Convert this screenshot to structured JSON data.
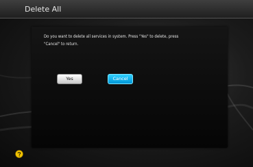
{
  "header": {
    "title": "Delete All"
  },
  "dialog": {
    "message": "Do you want to delete all services in system. Press \"Yes\" to delete, press \"Cancel\" to return.",
    "yes_label": "Yes",
    "cancel_label": "Cancel",
    "focused_button": "cancel"
  },
  "footer": {
    "help_icon": "question-icon"
  },
  "colors": {
    "title_text": "#e6e6e6",
    "cancel_accent": "#19b8f0",
    "help_icon": "#f2c300"
  }
}
